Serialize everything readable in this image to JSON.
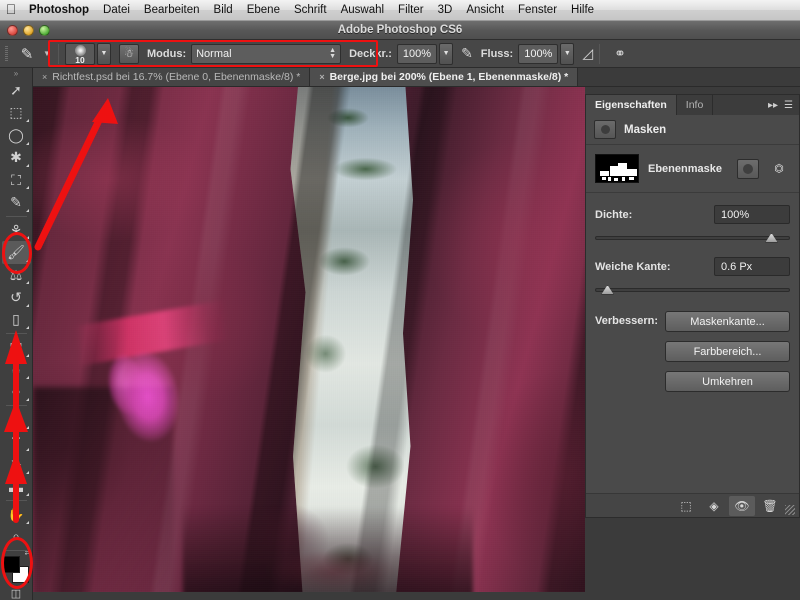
{
  "menubar": {
    "apple_icon": "apple-logo",
    "items": [
      {
        "label": "Photoshop",
        "bold": true
      },
      {
        "label": "Datei",
        "bold": false
      },
      {
        "label": "Bearbeiten",
        "bold": false
      },
      {
        "label": "Bild",
        "bold": false
      },
      {
        "label": "Ebene",
        "bold": false
      },
      {
        "label": "Schrift",
        "bold": false
      },
      {
        "label": "Auswahl",
        "bold": false
      },
      {
        "label": "Filter",
        "bold": false
      },
      {
        "label": "3D",
        "bold": false
      },
      {
        "label": "Ansicht",
        "bold": false
      },
      {
        "label": "Fenster",
        "bold": false
      },
      {
        "label": "Hilfe",
        "bold": false
      }
    ]
  },
  "window": {
    "title": "Adobe Photoshop CS6",
    "close_label": "close-button",
    "minimize_label": "minimize-button",
    "zoom_label": "zoom-button"
  },
  "options_bar": {
    "tool_icon": "brush-tool-icon",
    "brush_size": "10",
    "brush_preset_label": "brush-preset-picker",
    "tablet_pressure_icon": "tablet-pressure-icon",
    "mode_label": "Modus:",
    "mode_value": "Normal",
    "opacity_label": "Deckkr.:",
    "opacity_value": "100%",
    "flow_label": "Fluss:",
    "flow_value": "100%",
    "airbrush_icon": "airbrush-icon",
    "smoothing_icon": "brush-smoothing-icon"
  },
  "tabs": [
    {
      "title": "Richtfest.psd bei 16.7% (Ebene 0, Ebenenmaske/8) *",
      "active": false,
      "close": "×"
    },
    {
      "title": "Berge.jpg bei 200% (Ebene 1, Ebenenmaske/8) *",
      "active": true,
      "close": "×"
    }
  ],
  "toolbar": {
    "tools": [
      {
        "name": "move-tool",
        "glyph": "↖",
        "selected": false,
        "submenu": false
      },
      {
        "name": "marquee-tool",
        "glyph": "⬚",
        "selected": false,
        "submenu": true
      },
      {
        "name": "lasso-tool",
        "glyph": "◯",
        "selected": false,
        "submenu": true
      },
      {
        "name": "quick-selection-tool",
        "glyph": "✱",
        "selected": false,
        "submenu": true
      },
      {
        "name": "crop-tool",
        "glyph": "⛶",
        "selected": false,
        "submenu": true
      },
      {
        "name": "eyedropper-tool",
        "glyph": "✒",
        "selected": false,
        "submenu": true
      },
      {
        "name": "spot-healing-brush-tool",
        "glyph": "⊕",
        "selected": false,
        "submenu": true
      },
      {
        "name": "brush-tool",
        "glyph": "✎",
        "selected": true,
        "submenu": true
      },
      {
        "name": "clone-stamp-tool",
        "glyph": "⧉",
        "selected": false,
        "submenu": true
      },
      {
        "name": "history-brush-tool",
        "glyph": "↺",
        "selected": false,
        "submenu": true
      },
      {
        "name": "eraser-tool",
        "glyph": "▭",
        "selected": false,
        "submenu": true
      },
      {
        "name": "gradient-tool",
        "glyph": "▤",
        "selected": false,
        "submenu": true
      },
      {
        "name": "blur-tool",
        "glyph": "◌",
        "selected": false,
        "submenu": true
      },
      {
        "name": "dodge-tool",
        "glyph": "⚲",
        "selected": false,
        "submenu": true
      },
      {
        "name": "pen-tool",
        "glyph": "✑",
        "selected": false,
        "submenu": true
      },
      {
        "name": "type-tool",
        "glyph": "T",
        "selected": false,
        "submenu": true
      },
      {
        "name": "path-selection-tool",
        "glyph": "➤",
        "selected": false,
        "submenu": true
      },
      {
        "name": "rectangle-shape-tool",
        "glyph": "▬",
        "selected": false,
        "submenu": true
      },
      {
        "name": "hand-tool",
        "glyph": "✋",
        "selected": false,
        "submenu": true
      },
      {
        "name": "zoom-tool",
        "glyph": "⌕",
        "selected": false,
        "submenu": false
      }
    ],
    "foreground_color": "#000000",
    "background_color": "#ffffff",
    "quickmask_icon": "quick-mask-icon"
  },
  "panel": {
    "tabs": [
      {
        "label": "Eigenschaften",
        "active": true
      },
      {
        "label": "Info",
        "active": false
      }
    ],
    "collapse_icon": "collapse-panel-icon",
    "menu_icon": "panel-menu-icon",
    "title": "Masken",
    "title_icon": "pixel-mask-icon",
    "mask": {
      "name": "Ebenenmaske",
      "thumb_name": "layer-mask-thumbnail",
      "pixel_mask_button": "pixel-mask-button",
      "vector_mask_button": "vector-mask-button"
    },
    "density": {
      "label": "Dichte:",
      "value": "100%",
      "slider_percent": 100
    },
    "feather": {
      "label": "Weiche Kante:",
      "value": "0.6 Px",
      "slider_percent": 3
    },
    "refine": {
      "label": "Verbessern:",
      "buttons": [
        {
          "label": "Maskenkante..."
        },
        {
          "label": "Farbbereich..."
        },
        {
          "label": "Umkehren"
        }
      ]
    },
    "footer_icons": [
      {
        "name": "load-selection-from-mask-icon",
        "glyph": "⬚",
        "pressed": false
      },
      {
        "name": "apply-mask-icon",
        "glyph": "◈",
        "pressed": false
      },
      {
        "name": "toggle-mask-visibility-icon",
        "glyph": "◉",
        "pressed": true
      },
      {
        "name": "delete-mask-icon",
        "glyph": "🗑",
        "pressed": false
      }
    ]
  },
  "annotations": {
    "accent_color": "#ee1111",
    "options_highlight": "red-rectangle-options-bar",
    "brush_tool_circle": "red-circle-brush-tool",
    "color-swatch_circle": "red-circle-color-swatches",
    "arrow_to_options": "red-arrow-brush-to-options",
    "arrow_up_toolbar": "red-arrow-toolbar-up"
  },
  "canvas": {
    "name": "image-canvas",
    "description": "Berge.jpg bei 200%"
  }
}
